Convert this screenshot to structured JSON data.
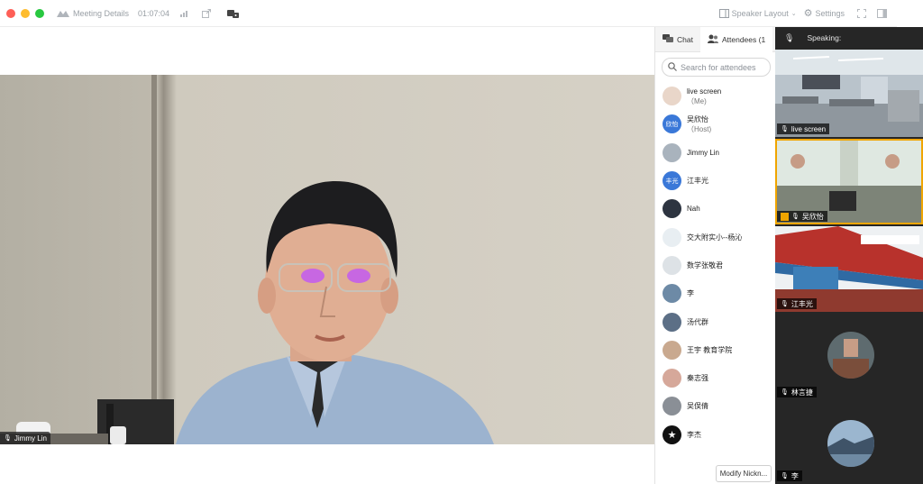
{
  "titlebar": {
    "meeting_details": "Meeting Details",
    "elapsed": "01:07:04",
    "speaker_layout": "Speaker Layout",
    "settings": "Settings"
  },
  "main_video": {
    "name": "Jimmy Lin"
  },
  "panel": {
    "tab_chat": "Chat",
    "tab_attendees": "Attendees (1",
    "search_placeholder": "Search for attendees",
    "modify_button": "Modify Nickn...",
    "attendees": [
      {
        "name": "live screen",
        "sub": "（Me)"
      },
      {
        "name": "吴欣怡",
        "sub": "（Host)",
        "initials": "欣怡"
      },
      {
        "name": "Jimmy Lin"
      },
      {
        "name": "江丰光",
        "initials": "丰光"
      },
      {
        "name": "Nah"
      },
      {
        "name": "交大附实小--杨沁"
      },
      {
        "name": "数学张敬君"
      },
      {
        "name": "李"
      },
      {
        "name": "汤代群"
      },
      {
        "name": "王宇 教育学院"
      },
      {
        "name": "秦志强"
      },
      {
        "name": "吴俣倩"
      },
      {
        "name": "李杰"
      }
    ]
  },
  "speakers": {
    "heading": "Speaking:",
    "tiles": [
      {
        "name": "live screen"
      },
      {
        "name": "吴欣怡"
      },
      {
        "name": "江丰光"
      },
      {
        "name": "林言捷"
      },
      {
        "name": "李"
      }
    ]
  },
  "colors": {
    "accent_blue": "#3a78d8",
    "speaker_bg": "#262626",
    "active_tile": "#f0a500"
  }
}
